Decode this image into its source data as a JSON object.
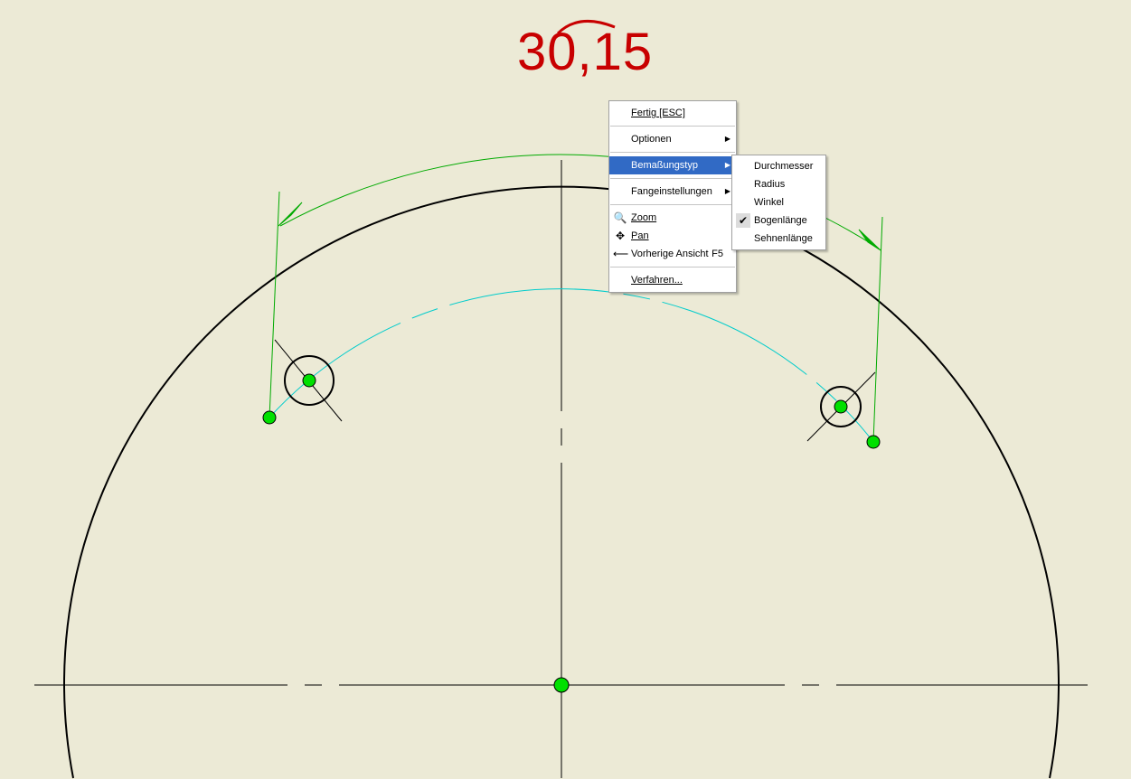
{
  "dimension_value": "30,15",
  "context_menu": {
    "items": [
      {
        "label": "Fertig [ESC]"
      },
      {
        "label": "Optionen"
      },
      {
        "label": "Bemaßungstyp"
      },
      {
        "label": "Fangeinstellungen"
      },
      {
        "label": "Zoom",
        "icon": "zoom-icon"
      },
      {
        "label": "Pan",
        "icon": "pan-icon"
      },
      {
        "label": "Vorherige Ansicht",
        "shortcut": "F5",
        "icon": "previous-view-icon"
      },
      {
        "label": "Verfahren..."
      }
    ]
  },
  "submenu": {
    "items": [
      {
        "label": "Durchmesser"
      },
      {
        "label": "Radius"
      },
      {
        "label": "Winkel"
      },
      {
        "label": "Bogenlänge",
        "checked": true
      },
      {
        "label": "Sehnenlänge"
      }
    ]
  },
  "colors": {
    "background": "#ECEAD6",
    "dimension": "#C80000",
    "highlight": "#316AC5",
    "construction": "#00CCCC",
    "dim_lines": "#00AA00"
  }
}
